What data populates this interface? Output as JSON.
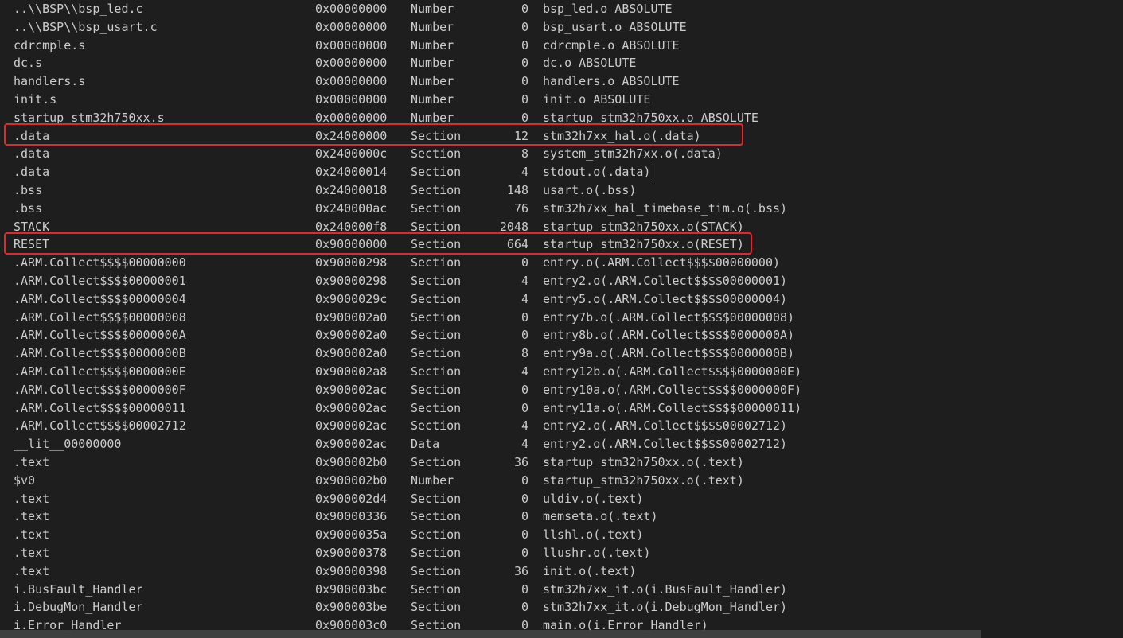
{
  "rows": [
    {
      "symbol": "..\\\\BSP\\\\bsp_led.c",
      "value": "0x00000000",
      "type": "Number",
      "size": "0",
      "object": "bsp_led.o ABSOLUTE"
    },
    {
      "symbol": "..\\\\BSP\\\\bsp_usart.c",
      "value": "0x00000000",
      "type": "Number",
      "size": "0",
      "object": "bsp_usart.o ABSOLUTE"
    },
    {
      "symbol": "cdrcmple.s",
      "value": "0x00000000",
      "type": "Number",
      "size": "0",
      "object": "cdrcmple.o ABSOLUTE"
    },
    {
      "symbol": "dc.s",
      "value": "0x00000000",
      "type": "Number",
      "size": "0",
      "object": "dc.o ABSOLUTE"
    },
    {
      "symbol": "handlers.s",
      "value": "0x00000000",
      "type": "Number",
      "size": "0",
      "object": "handlers.o ABSOLUTE"
    },
    {
      "symbol": "init.s",
      "value": "0x00000000",
      "type": "Number",
      "size": "0",
      "object": "init.o ABSOLUTE"
    },
    {
      "symbol": "startup_stm32h750xx.s",
      "value": "0x00000000",
      "type": "Number",
      "size": "0",
      "object": "startup_stm32h750xx.o ABSOLUTE"
    },
    {
      "symbol": ".data",
      "value": "0x24000000",
      "type": "Section",
      "size": "12",
      "object": "stm32h7xx_hal.o(.data)"
    },
    {
      "symbol": ".data",
      "value": "0x2400000c",
      "type": "Section",
      "size": "8",
      "object": "system_stm32h7xx.o(.data)"
    },
    {
      "symbol": ".data",
      "value": "0x24000014",
      "type": "Section",
      "size": "4",
      "object": "stdout.o(.data)"
    },
    {
      "symbol": ".bss",
      "value": "0x24000018",
      "type": "Section",
      "size": "148",
      "object": "usart.o(.bss)"
    },
    {
      "symbol": ".bss",
      "value": "0x240000ac",
      "type": "Section",
      "size": "76",
      "object": "stm32h7xx_hal_timebase_tim.o(.bss)"
    },
    {
      "symbol": "STACK",
      "value": "0x240000f8",
      "type": "Section",
      "size": "2048",
      "object": "startup_stm32h750xx.o(STACK)"
    },
    {
      "symbol": "RESET",
      "value": "0x90000000",
      "type": "Section",
      "size": "664",
      "object": "startup_stm32h750xx.o(RESET)"
    },
    {
      "symbol": ".ARM.Collect$$$$00000000",
      "value": "0x90000298",
      "type": "Section",
      "size": "0",
      "object": "entry.o(.ARM.Collect$$$$00000000)"
    },
    {
      "symbol": ".ARM.Collect$$$$00000001",
      "value": "0x90000298",
      "type": "Section",
      "size": "4",
      "object": "entry2.o(.ARM.Collect$$$$00000001)"
    },
    {
      "symbol": ".ARM.Collect$$$$00000004",
      "value": "0x9000029c",
      "type": "Section",
      "size": "4",
      "object": "entry5.o(.ARM.Collect$$$$00000004)"
    },
    {
      "symbol": ".ARM.Collect$$$$00000008",
      "value": "0x900002a0",
      "type": "Section",
      "size": "0",
      "object": "entry7b.o(.ARM.Collect$$$$00000008)"
    },
    {
      "symbol": ".ARM.Collect$$$$0000000A",
      "value": "0x900002a0",
      "type": "Section",
      "size": "0",
      "object": "entry8b.o(.ARM.Collect$$$$0000000A)"
    },
    {
      "symbol": ".ARM.Collect$$$$0000000B",
      "value": "0x900002a0",
      "type": "Section",
      "size": "8",
      "object": "entry9a.o(.ARM.Collect$$$$0000000B)"
    },
    {
      "symbol": ".ARM.Collect$$$$0000000E",
      "value": "0x900002a8",
      "type": "Section",
      "size": "4",
      "object": "entry12b.o(.ARM.Collect$$$$0000000E)"
    },
    {
      "symbol": ".ARM.Collect$$$$0000000F",
      "value": "0x900002ac",
      "type": "Section",
      "size": "0",
      "object": "entry10a.o(.ARM.Collect$$$$0000000F)"
    },
    {
      "symbol": ".ARM.Collect$$$$00000011",
      "value": "0x900002ac",
      "type": "Section",
      "size": "0",
      "object": "entry11a.o(.ARM.Collect$$$$00000011)"
    },
    {
      "symbol": ".ARM.Collect$$$$00002712",
      "value": "0x900002ac",
      "type": "Section",
      "size": "4",
      "object": "entry2.o(.ARM.Collect$$$$00002712)"
    },
    {
      "symbol": "__lit__00000000",
      "value": "0x900002ac",
      "type": "Data",
      "size": "4",
      "object": "entry2.o(.ARM.Collect$$$$00002712)"
    },
    {
      "symbol": ".text",
      "value": "0x900002b0",
      "type": "Section",
      "size": "36",
      "object": "startup_stm32h750xx.o(.text)"
    },
    {
      "symbol": "$v0",
      "value": "0x900002b0",
      "type": "Number",
      "size": "0",
      "object": "startup_stm32h750xx.o(.text)"
    },
    {
      "symbol": ".text",
      "value": "0x900002d4",
      "type": "Section",
      "size": "0",
      "object": "uldiv.o(.text)"
    },
    {
      "symbol": ".text",
      "value": "0x90000336",
      "type": "Section",
      "size": "0",
      "object": "memseta.o(.text)"
    },
    {
      "symbol": ".text",
      "value": "0x9000035a",
      "type": "Section",
      "size": "0",
      "object": "llshl.o(.text)"
    },
    {
      "symbol": ".text",
      "value": "0x90000378",
      "type": "Section",
      "size": "0",
      "object": "llushr.o(.text)"
    },
    {
      "symbol": ".text",
      "value": "0x90000398",
      "type": "Section",
      "size": "36",
      "object": "init.o(.text)"
    },
    {
      "symbol": "i.BusFault_Handler",
      "value": "0x900003bc",
      "type": "Section",
      "size": "0",
      "object": "stm32h7xx_it.o(i.BusFault_Handler)"
    },
    {
      "symbol": "i.DebugMon_Handler",
      "value": "0x900003be",
      "type": "Section",
      "size": "0",
      "object": "stm32h7xx_it.o(i.DebugMon_Handler)"
    },
    {
      "symbol": "i.Error_Handler",
      "value": "0x900003c0",
      "type": "Section",
      "size": "0",
      "object": "main.o(i.Error_Handler)"
    }
  ],
  "highlight_color": "#e8262a",
  "background_color": "#1e1e1e",
  "text_color": "#cccccc"
}
